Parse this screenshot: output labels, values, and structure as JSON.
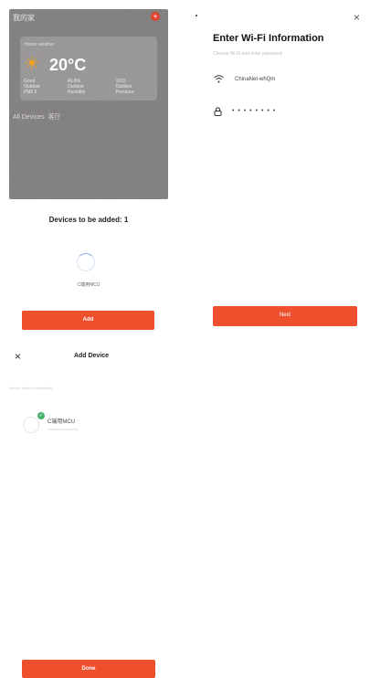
{
  "home": {
    "top_label": "我的家",
    "weather_label": "Home weather",
    "temperature": "20°C",
    "stats": [
      "Good",
      "45.8%",
      "1015"
    ],
    "stats_sub": [
      "Outdoor PM2.5",
      "Outdoor Humidity",
      "Outdoor Pressure"
    ],
    "all_devices": "All Devices",
    "room": "客厅"
  },
  "pairing": {
    "devices_to_add": "Devices to be added: 1",
    "device_name": "C端用MCU",
    "add_button": "Add"
  },
  "wifi": {
    "close": "×",
    "title": "Enter Wi-Fi Information",
    "subtitle": "Choose Wi-Fi and enter password",
    "ssid": "ChinaNet-whQm",
    "password_mask": "• • • • • • • •",
    "next_button": "Next"
  },
  "add_device": {
    "close": "×",
    "title": "Add Device",
    "subtitle": "Device added successfully",
    "device_name": "C端用MCU",
    "device_status": "Added successfully",
    "done_button": "Done"
  },
  "colors": {
    "accent": "#ee4f2d",
    "success": "#46b36b",
    "overlay": "#837f7f"
  },
  "icons": {
    "wifi": "wifi-icon",
    "lock": "lock-icon",
    "close": "close-icon",
    "check": "check-icon",
    "sun": "sun-icon",
    "add": "plus-icon"
  }
}
